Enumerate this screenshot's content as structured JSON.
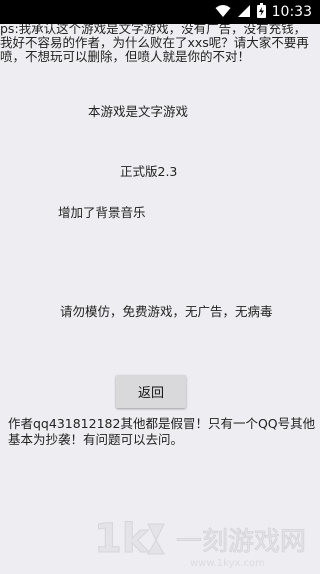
{
  "status_bar": {
    "time": "10:33",
    "icons": [
      "wifi-icon",
      "cellular-signal-icon",
      "battery-charging-icon"
    ]
  },
  "notice_text": "ps:我承认这个游戏是文字游戏，没有广告，没有充钱，我好不容易的作者，为什么败在了xxs呢？请大家不要再喷，不想玩可以删除，但喷人就是你的不对！",
  "title": "本游戏是文字游戏",
  "version": "正式版2.3",
  "music_note": "增加了背景音乐",
  "no_copy_note": "请勿模仿，免费游戏，无广告，无病毒",
  "back_button_label": "返回",
  "author_note": "作者qq431812182其他都是假冒！只有一个QQ号其他基本为抄袭！有问题可以去问。",
  "watermark": {
    "logo": "1k",
    "text": "一刻游戏网",
    "url": "www.1kyx.com"
  }
}
